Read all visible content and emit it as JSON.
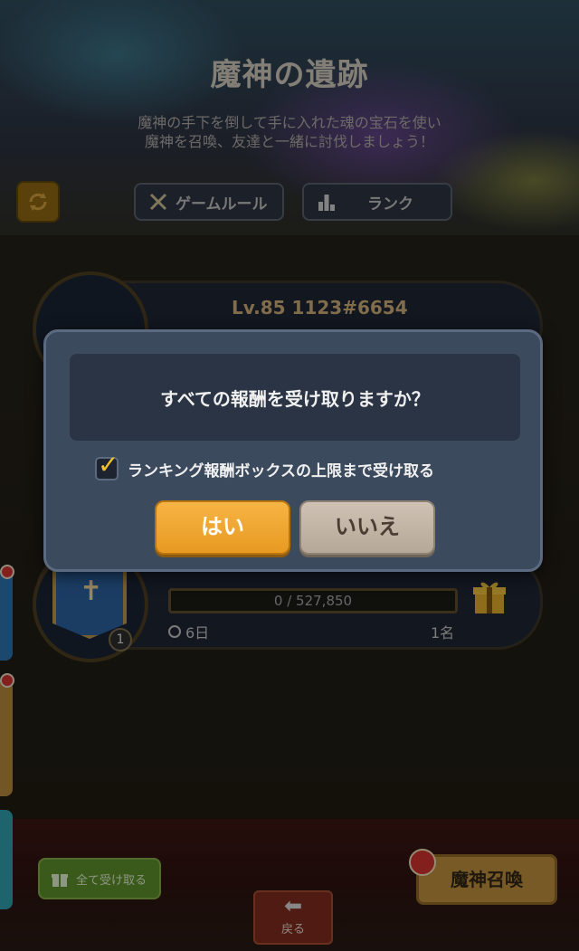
{
  "header": {
    "title": "魔神の遺跡",
    "description_line1": "魔神の手下を倒して手に入れた魂の宝石を使い",
    "description_line2": "魔神を召喚、友達と一緒に討伐しましょう！"
  },
  "top_buttons": {
    "rules_label": "ゲームルール",
    "rank_label": "ランク"
  },
  "card1": {
    "level_label": "Lv.85 1123#6654"
  },
  "card3": {
    "emblem_number": "1",
    "progress_text": "0 / 527,850",
    "days_left": "6日",
    "participants": "1名"
  },
  "dialog": {
    "message": "すべての報酬を受け取りますか？",
    "checkbox_label": "ランキング報酬ボックスの上限まで受け取る",
    "checkbox_checked": true,
    "yes_label": "はい",
    "no_label": "いいえ"
  },
  "bottom": {
    "claim_all_label": "全て受け取る",
    "summon_label": "魔神召喚",
    "back_label": "戻る"
  },
  "colors": {
    "yes_button": "#e89a22",
    "no_button": "#b6a898",
    "dialog_bg": "#3c4a5e",
    "level_text": "#c6a874"
  }
}
